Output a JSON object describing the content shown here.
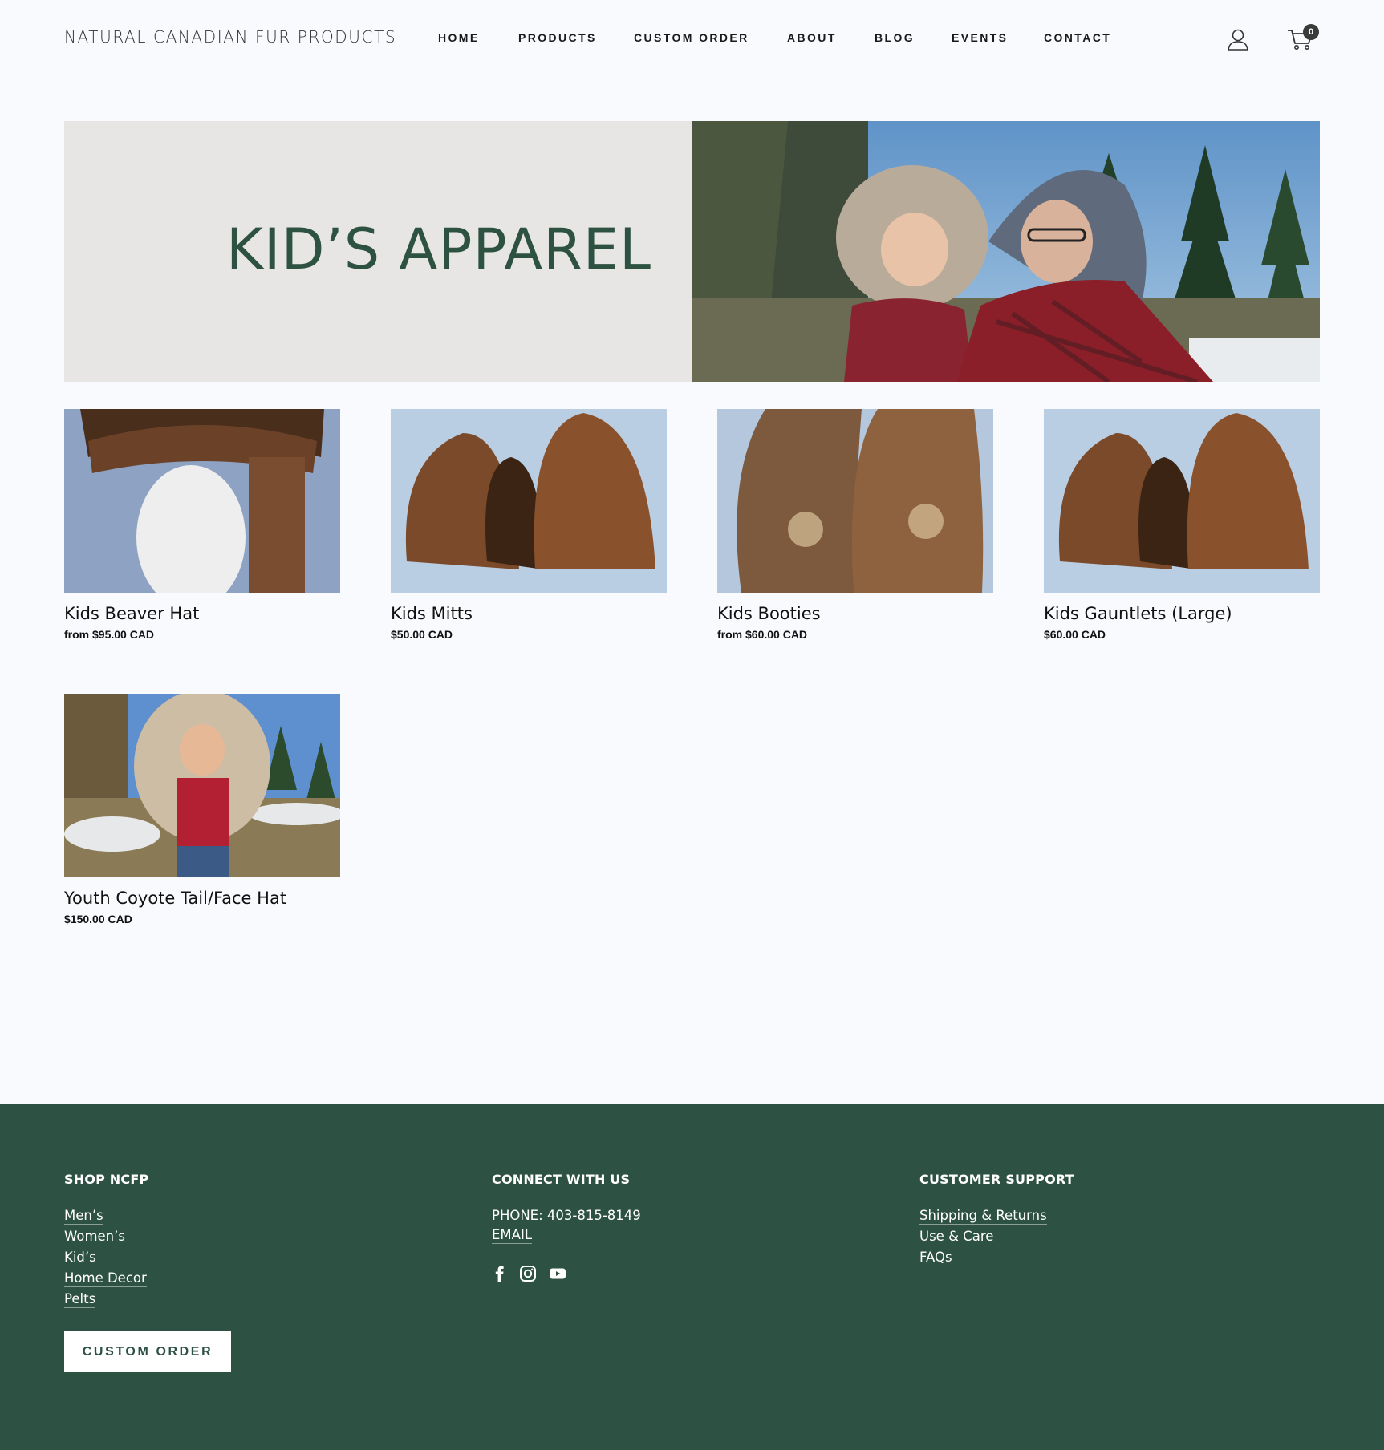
{
  "header": {
    "logo": "NATURAL CANADIAN FUR PRODUCTS",
    "nav": [
      "HOME",
      "PRODUCTS",
      "CUSTOM ORDER",
      "ABOUT",
      "BLOG",
      "EVENTS",
      "CONTACT"
    ],
    "cart_count": "0"
  },
  "hero": {
    "title": "KID’S APPAREL"
  },
  "products": [
    {
      "name": "Kids Beaver Hat",
      "price": "from $95.00 CAD"
    },
    {
      "name": "Kids Mitts",
      "price": "$50.00 CAD"
    },
    {
      "name": "Kids Booties",
      "price": "from $60.00 CAD"
    },
    {
      "name": "Kids Gauntlets (Large)",
      "price": "$60.00 CAD"
    },
    {
      "name": "Youth Coyote Tail/Face Hat",
      "price": "$150.00 CAD"
    }
  ],
  "footer": {
    "shop": {
      "heading": "SHOP NCFP",
      "links": [
        "Men’s",
        "Women’s",
        "Kid’s",
        "Home Decor",
        "Pelts"
      ]
    },
    "connect": {
      "heading": "CONNECT WITH US",
      "phone": "PHONE: 403-815-8149",
      "email": "EMAIL",
      "icons": [
        "facebook-icon",
        "instagram-icon",
        "youtube-icon"
      ]
    },
    "support": {
      "heading": "CUSTOMER SUPPORT",
      "links": [
        "Shipping & Returns",
        "Use & Care",
        "FAQs"
      ]
    },
    "custom_order_button": "CUSTOM ORDER"
  },
  "colors": {
    "brand_green": "#2d5143",
    "hero_text": "#2e5242",
    "page_bg": "#f9fafd",
    "hero_panel": "#e7e6e4"
  }
}
